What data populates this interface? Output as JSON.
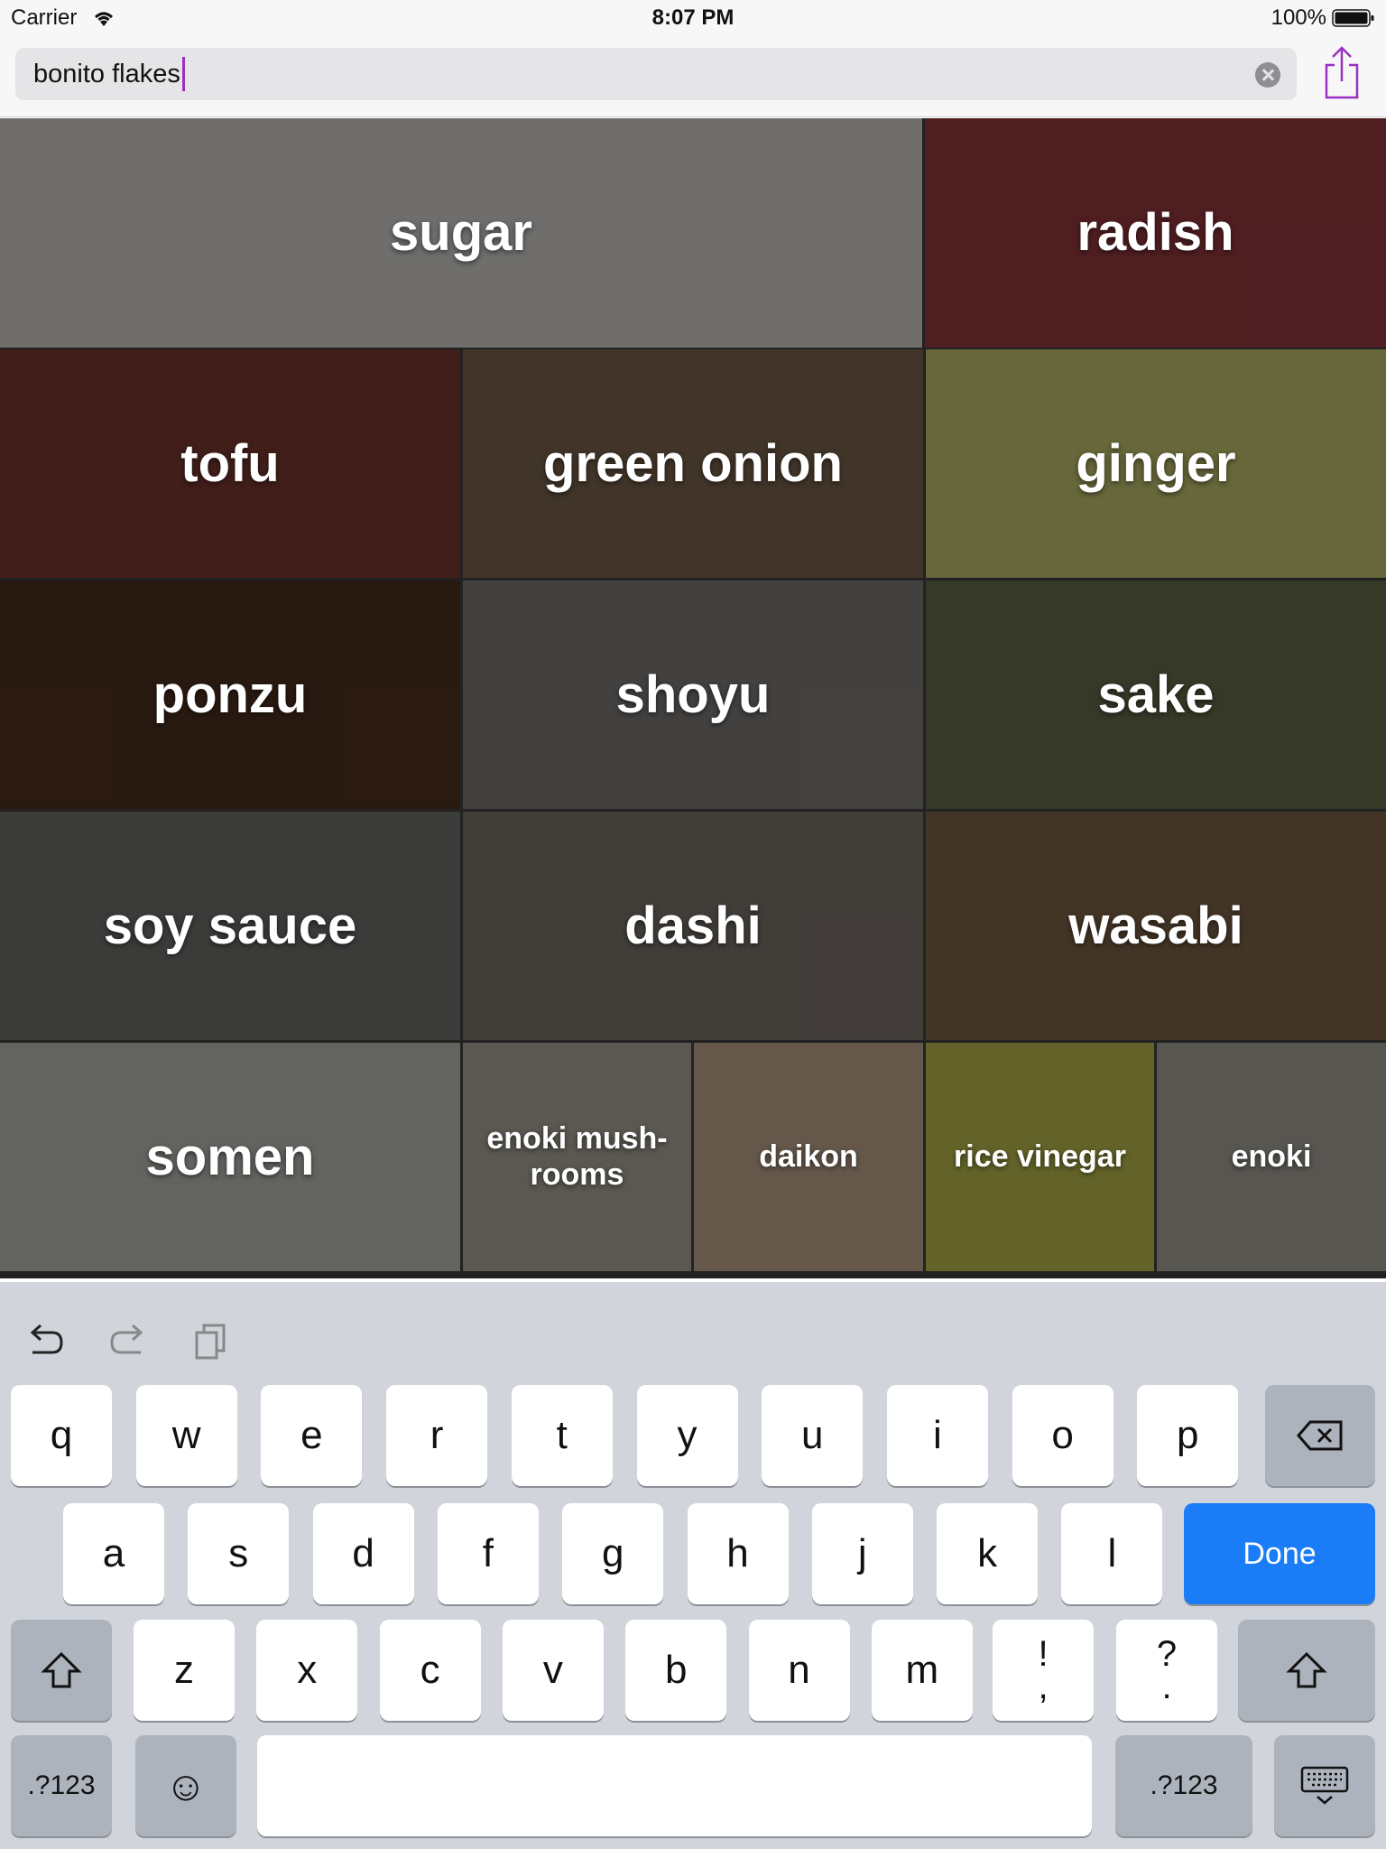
{
  "status_bar": {
    "carrier": "Carrier",
    "time": "8:07 PM",
    "battery": "100%"
  },
  "search": {
    "value": "bonito flakes",
    "placeholder": ""
  },
  "tiles": [
    {
      "label": "sugar",
      "bg": "#9a9996"
    },
    {
      "label": "radish",
      "bg": "#6e2a2f"
    },
    {
      "label": "tofu",
      "bg": "#5a2a25"
    },
    {
      "label": "green onion",
      "bg": "#5a4a3a"
    },
    {
      "label": "ginger",
      "bg": "#8f8f52"
    },
    {
      "label": "ponzu",
      "bg": "#3a2418"
    },
    {
      "label": "shoyu",
      "bg": "#5e5a58"
    },
    {
      "label": "sake",
      "bg": "#4c5038"
    },
    {
      "label": "soy sauce",
      "bg": "#53524f"
    },
    {
      "label": "dashi",
      "bg": "#5b5550"
    },
    {
      "label": "wasabi",
      "bg": "#5d4a35"
    },
    {
      "label": "somen",
      "bg": "#8a8a86"
    },
    {
      "label": "enoki mush-\nrooms",
      "bg": "#7d7a70"
    },
    {
      "label": "daikon",
      "bg": "#8c7a68"
    },
    {
      "label": "rice vinegar",
      "bg": "#8a8a3a"
    },
    {
      "label": "enoki",
      "bg": "#7a7870"
    }
  ],
  "keyboard": {
    "row1": [
      "q",
      "w",
      "e",
      "r",
      "t",
      "y",
      "u",
      "i",
      "o",
      "p"
    ],
    "row2": [
      "a",
      "s",
      "d",
      "f",
      "g",
      "h",
      "j",
      "k",
      "l"
    ],
    "row3": [
      "z",
      "x",
      "c",
      "v",
      "b",
      "n",
      "m"
    ],
    "punct1": {
      "top": "!",
      "bottom": ","
    },
    "punct2": {
      "top": "?",
      "bottom": "."
    },
    "done_label": "Done",
    "numbers_label": ".?123",
    "emoji_glyph": "☺",
    "accent": "#1a7cf6"
  },
  "icons": {
    "wifi": "wifi-icon",
    "battery": "battery-icon",
    "clear": "clear-icon",
    "share": "share-icon",
    "undo": "undo-icon",
    "redo": "redo-icon",
    "paste": "paste-icon",
    "delete": "delete-icon",
    "shift": "shift-icon",
    "hide_keyboard": "keyboard-hide-icon"
  }
}
